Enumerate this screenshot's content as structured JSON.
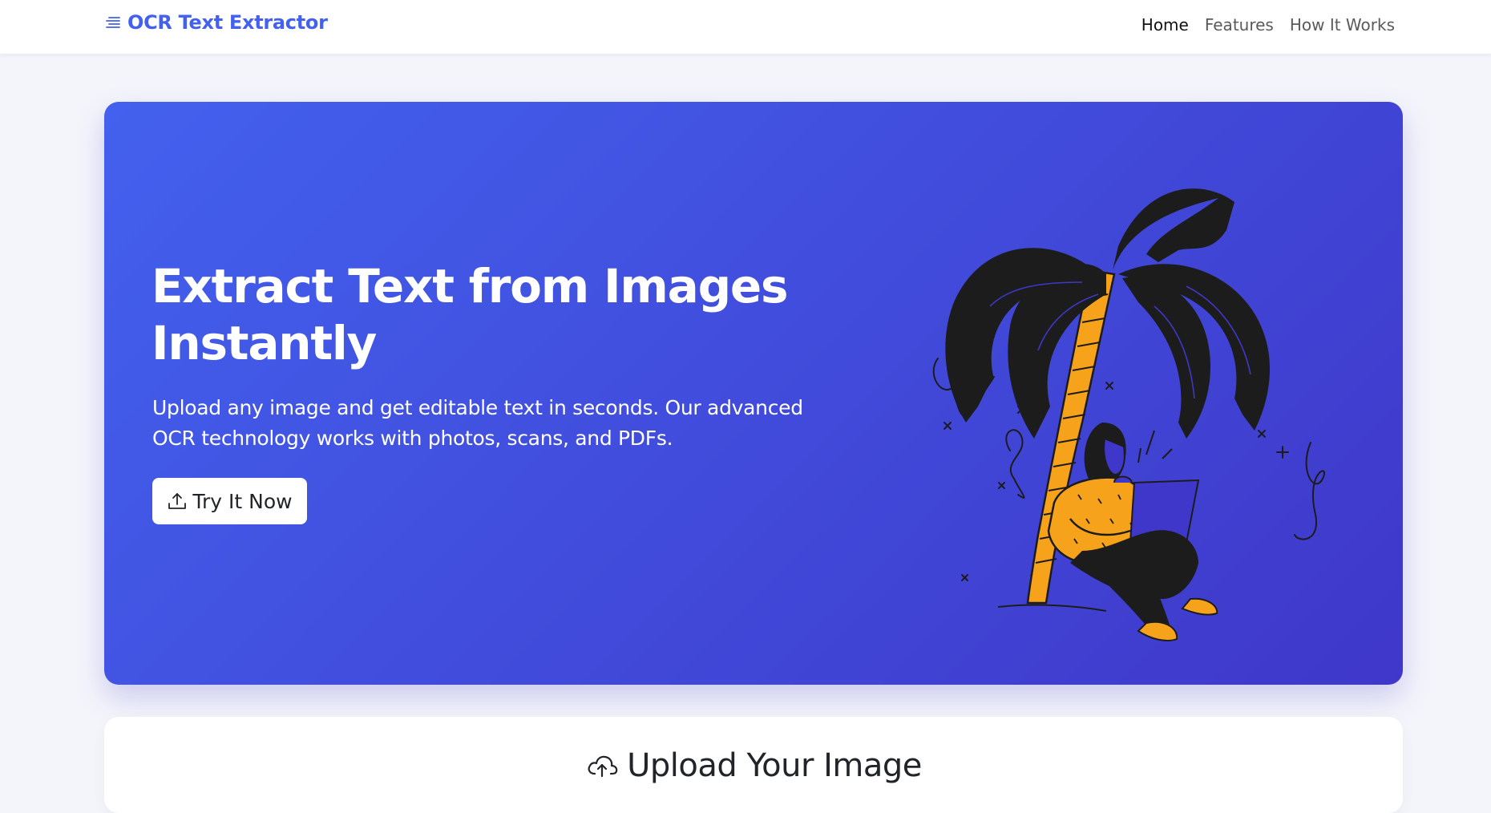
{
  "nav": {
    "brand": "OCR Text Extractor",
    "brand_icon": "text-lines-icon",
    "links": [
      "Home",
      "Features",
      "How It Works"
    ],
    "active": "Home"
  },
  "hero": {
    "title_line1": "Extract Text from Images",
    "title_line2": "Instantly",
    "subtitle": "Upload any image and get editable text in seconds. Our advanced OCR technology works with photos, scans, and PDFs.",
    "cta_label": "Try It Now",
    "cta_icon": "upload-icon",
    "illustration": "woman-under-palm-tree-with-laptop-illustration"
  },
  "upload": {
    "title": "Upload Your Image",
    "icon": "cloud-upload-icon"
  },
  "colors": {
    "brand": "#4361ee",
    "gradient_start": "#4361ee",
    "gradient_end": "#3f37c9",
    "accent_orange": "#f7a21b",
    "ink": "#1c1c1c"
  }
}
